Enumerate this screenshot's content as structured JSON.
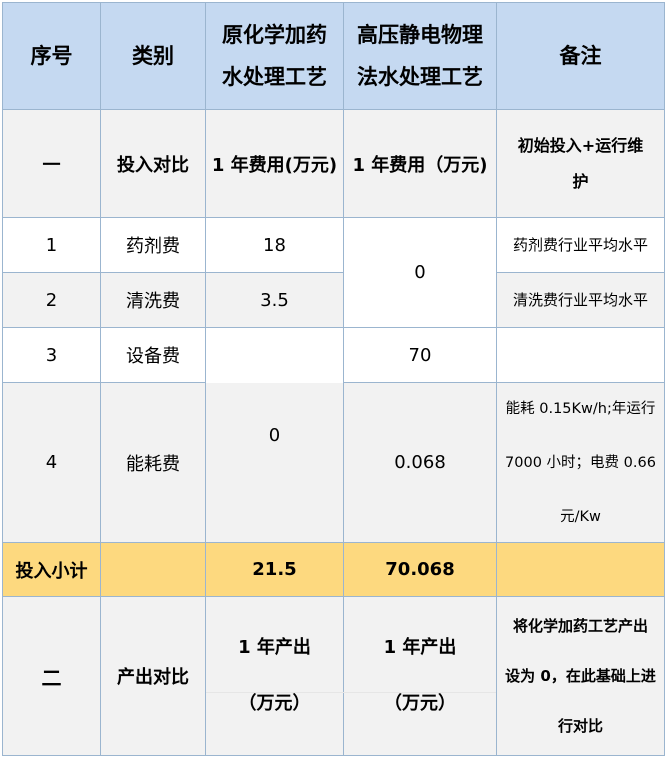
{
  "header": {
    "col1": "序号",
    "col2": "类别",
    "col3_line1": "原化学加药",
    "col3_line2": "水处理工艺",
    "col4_line1": "高压静电物理",
    "col4_line2": "法水处理工艺",
    "col5": "备注"
  },
  "section1": {
    "no": "一",
    "category": "投入对比",
    "col3": "1 年费用(万元)",
    "col4": "1 年费用（万元)",
    "note_line1": "初始投入+运行维",
    "note_line2": "护"
  },
  "rows": [
    {
      "no": "1",
      "category": "药剂费",
      "chem": "18",
      "note": "药剂费行业平均水平"
    },
    {
      "no": "2",
      "category": "清洗费",
      "chem": "3.5",
      "note": "清洗费行业平均水平"
    },
    {
      "no": "3",
      "category": "设备费",
      "phys": "70"
    },
    {
      "no": "4",
      "category": "能耗费",
      "phys": "0.068",
      "note_line1": "能耗 0.15Kw/h;年运行",
      "note_line2": "7000 小时；电费 0.66",
      "note_line3": "元/Kw"
    }
  ],
  "merged": {
    "phys_rows_1_2": "0",
    "chem_rows_3_4": "0"
  },
  "subtotal": {
    "label": "投入小计",
    "chem": "21.5",
    "phys": "70.068"
  },
  "section2": {
    "no": "二",
    "category": "产出对比",
    "col3_line1": "1 年产出",
    "col3_line2": "（万元）",
    "col4_line1": "1 年产出",
    "col4_line2": "（万元）",
    "note_line1": "将化学加药工艺产出",
    "note_line2": "设为 0，在此基础上进",
    "note_line3": "行对比"
  },
  "colors": {
    "header_bg": "#c5d9f1",
    "section_bg": "#f2f2f2",
    "subtotal_bg": "#fdd97f",
    "border": "#9bb5cf"
  }
}
